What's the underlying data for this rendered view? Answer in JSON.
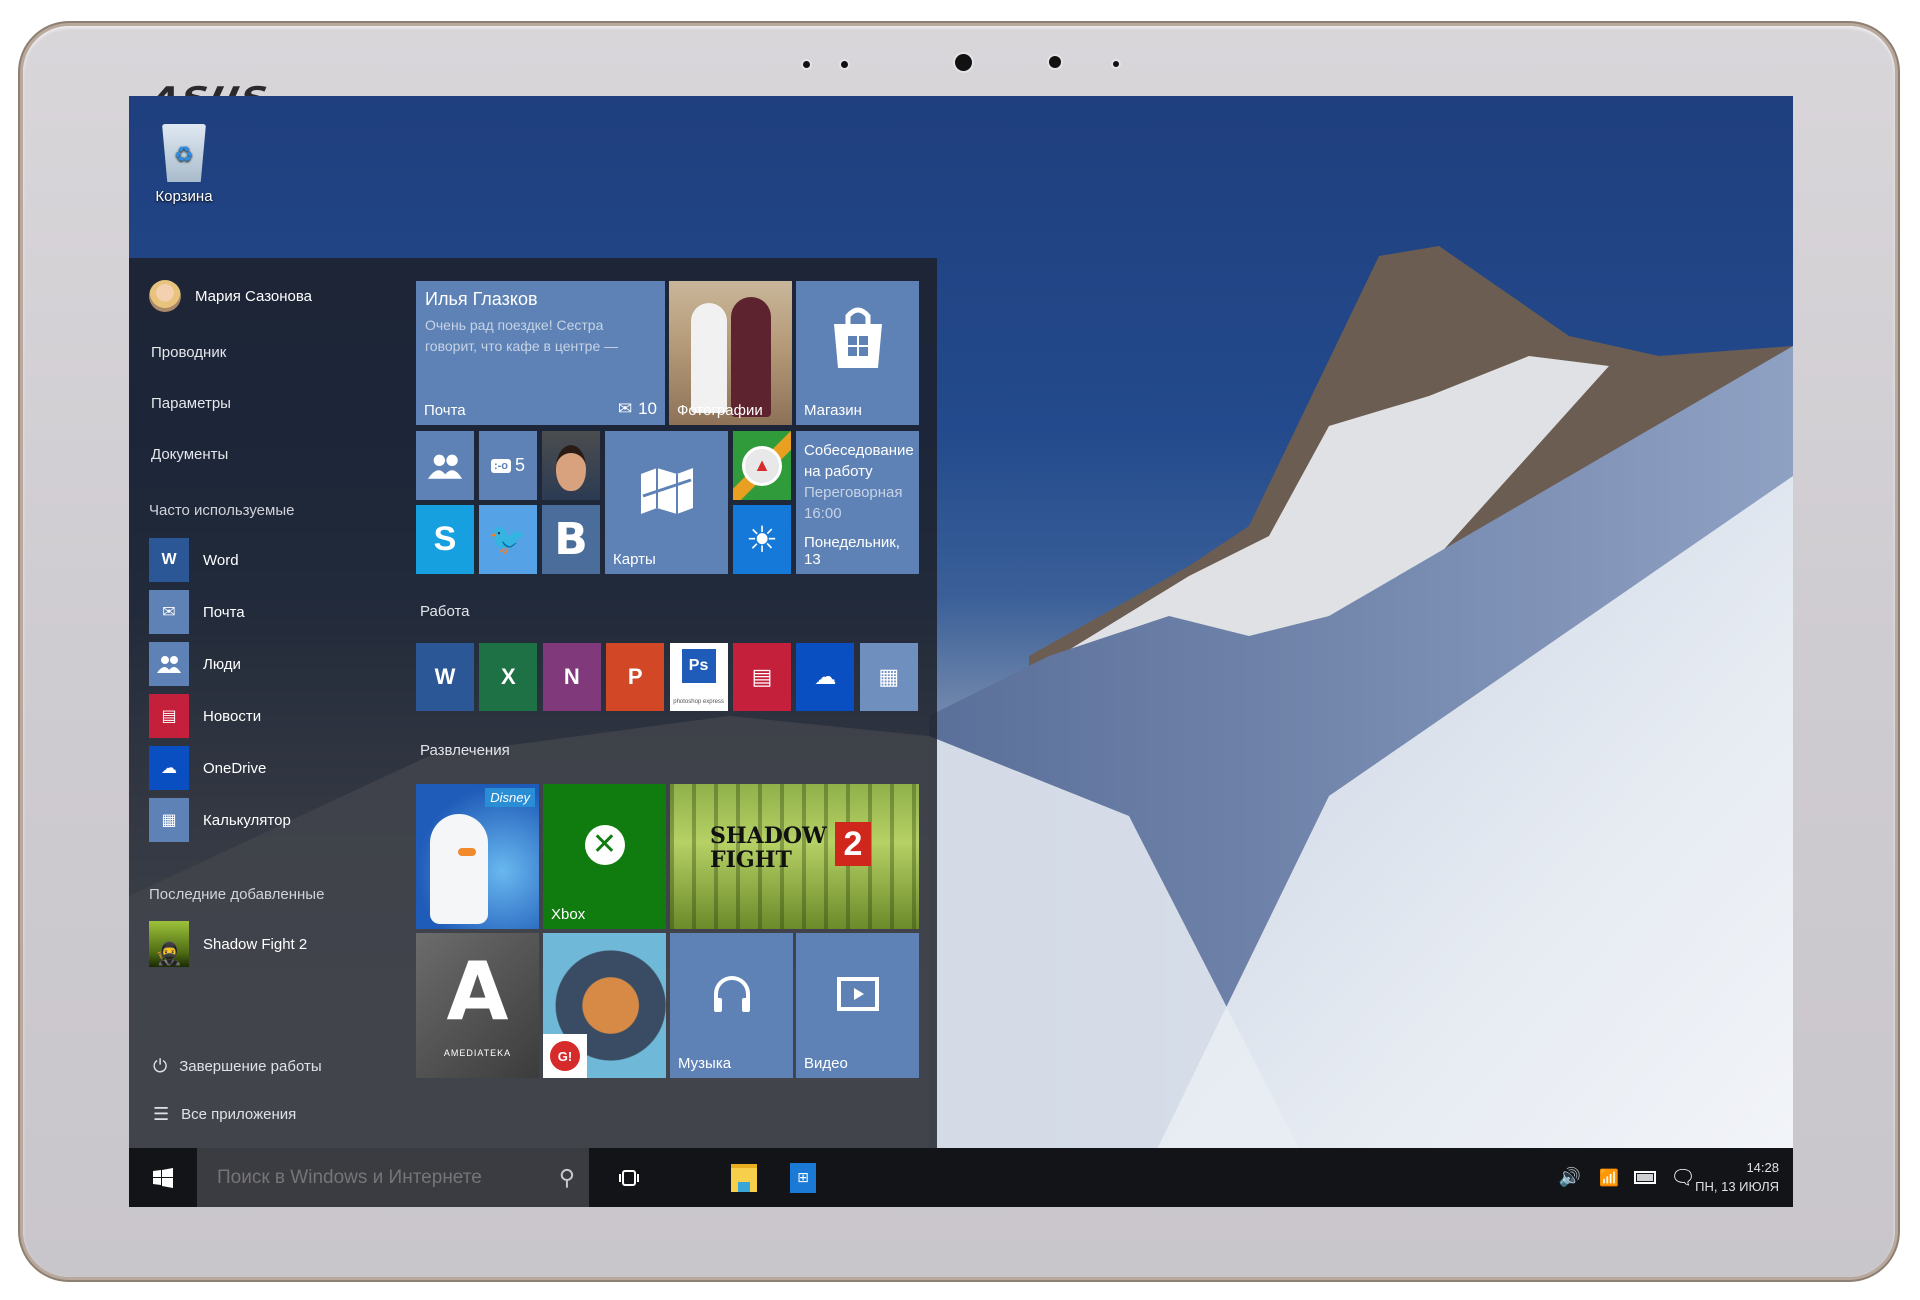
{
  "device": {
    "brand": "ASUS"
  },
  "desktop": {
    "recycle_bin_label": "Корзина"
  },
  "start_menu": {
    "user_name": "Мария Сазонова",
    "places": [
      "Проводник",
      "Параметры",
      "Документы"
    ],
    "frequent_header": "Часто используемые",
    "frequent": [
      {
        "label": "Word",
        "icon": "word-icon",
        "color": "#2b5797",
        "glyph": "W"
      },
      {
        "label": "Почта",
        "icon": "mail-icon",
        "color": "#5e82b5",
        "glyph": "✉"
      },
      {
        "label": "Люди",
        "icon": "people-icon",
        "color": "#5e82b5",
        "glyph": "👥"
      },
      {
        "label": "Новости",
        "icon": "news-icon",
        "color": "#c4203b",
        "glyph": "▤"
      },
      {
        "label": "OneDrive",
        "icon": "onedrive-icon",
        "color": "#0a4fc2",
        "glyph": "☁"
      },
      {
        "label": "Калькулятор",
        "icon": "calculator-icon",
        "color": "#5e82b5",
        "glyph": "▦"
      }
    ],
    "recent_header": "Последние добавленные",
    "recent": [
      {
        "label": "Shadow Fight 2",
        "icon": "shadow-fight-icon"
      }
    ],
    "power_label": "Завершение работы",
    "all_apps_label": "Все приложения"
  },
  "tiles": {
    "mail": {
      "sender": "Илья Глазков",
      "preview_line1": "Очень рад поездке! Сестра",
      "preview_line2": "говорит, что кафе в центре —",
      "label": "Почта",
      "count": "10"
    },
    "photos": {
      "label": "Фотографии"
    },
    "store": {
      "label": "Магазин"
    },
    "messaging": {
      "count": "5"
    },
    "maps": {
      "label": "Карты"
    },
    "calendar": {
      "title_line1": "Собеседование",
      "title_line2": "на работу",
      "place": "Переговорная",
      "time": "16:00",
      "date": "Понедельник, 13"
    },
    "vk": {
      "glyph": "B"
    },
    "work_group": "Работа",
    "work_apps": [
      {
        "name": "Word",
        "color": "#2b5797",
        "glyph": "W"
      },
      {
        "name": "Excel",
        "color": "#1e7145",
        "glyph": "X"
      },
      {
        "name": "OneNote",
        "color": "#80397b",
        "glyph": "N"
      },
      {
        "name": "PowerPoint",
        "color": "#d24726",
        "glyph": "P"
      },
      {
        "name": "Photoshop Express",
        "color": "#ffffff",
        "glyph": "Ps",
        "caption": "photoshop express"
      },
      {
        "name": "Новости",
        "color": "#c4203b",
        "glyph": "▤"
      },
      {
        "name": "OneDrive",
        "color": "#0a4fc2",
        "glyph": "☁"
      },
      {
        "name": "Калькулятор",
        "color": "#6f8fbf",
        "glyph": "▦"
      }
    ],
    "fun_group": "Развлечения",
    "disney": {
      "badge": "Disney"
    },
    "xbox": {
      "label": "Xbox"
    },
    "shadow_fight": {
      "title": "SHADOW FIGHT",
      "number": "2"
    },
    "amediateka": {
      "letter": "A",
      "caption": "AMEDIATEKA"
    },
    "game_badge": {
      "glyph": "G!"
    },
    "music": {
      "label": "Музыка"
    },
    "video": {
      "label": "Видео"
    }
  },
  "taskbar": {
    "search_placeholder": "Поиск в Windows и Интернете",
    "time": "14:28",
    "date": "ПН, 13 ИЮЛЯ"
  }
}
